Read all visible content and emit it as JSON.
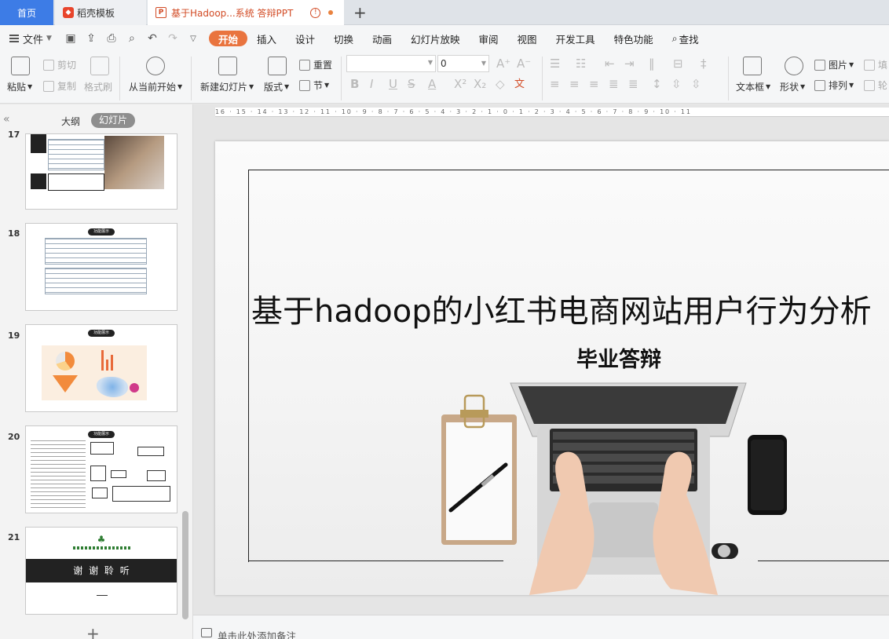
{
  "tabs": {
    "home": "首页",
    "template": "稻壳模板",
    "document": "基于Hadoop...系统 答辩PPT",
    "add": "+"
  },
  "menubar": {
    "file": "文件",
    "items": [
      "开始",
      "插入",
      "设计",
      "切换",
      "动画",
      "幻灯片放映",
      "审阅",
      "视图",
      "开发工具",
      "特色功能",
      "查找"
    ],
    "active": "开始"
  },
  "ribbon": {
    "paste": "粘贴",
    "cut": "剪切",
    "copy": "复制",
    "format_painter": "格式刷",
    "play_from_current": "从当前开始",
    "new_slide": "新建幻灯片",
    "layout": "版式",
    "reset": "重置",
    "section": "节",
    "font_size": "0",
    "text_box": "文本框",
    "shape": "形状",
    "picture": "图片",
    "arrange": "排列",
    "fill_partial": "填",
    "outline_partial": "轮"
  },
  "left_panel": {
    "outline_tab": "大纲",
    "slides_tab": "幻灯片",
    "thumbnails": [
      {
        "number": "17"
      },
      {
        "number": "18",
        "pill": "功能展示"
      },
      {
        "number": "19",
        "pill": "功能展示"
      },
      {
        "number": "20",
        "pill": "功能展示"
      },
      {
        "number": "21",
        "caption": "谢 谢 聆 听"
      }
    ]
  },
  "ruler": {
    "ticks": "16 · 15 · 14 · 13 · 12 · 11 · 10 · 9 · 8 · 7 · 6 · 5 · 4 · 3 · 2 · 1 · 0 · 1 · 2 · 3 · 4 · 5 · 6 · 7 · 8 · 9 · 10 · 11"
  },
  "slide": {
    "title": "基于hadoop的小红书电商网站用户行为分析",
    "subtitle": "毕业答辩"
  },
  "notes": {
    "placeholder": "单击此处添加备注"
  },
  "colors": {
    "accent": "#e9743f",
    "home_tab": "#3d7ce6"
  }
}
